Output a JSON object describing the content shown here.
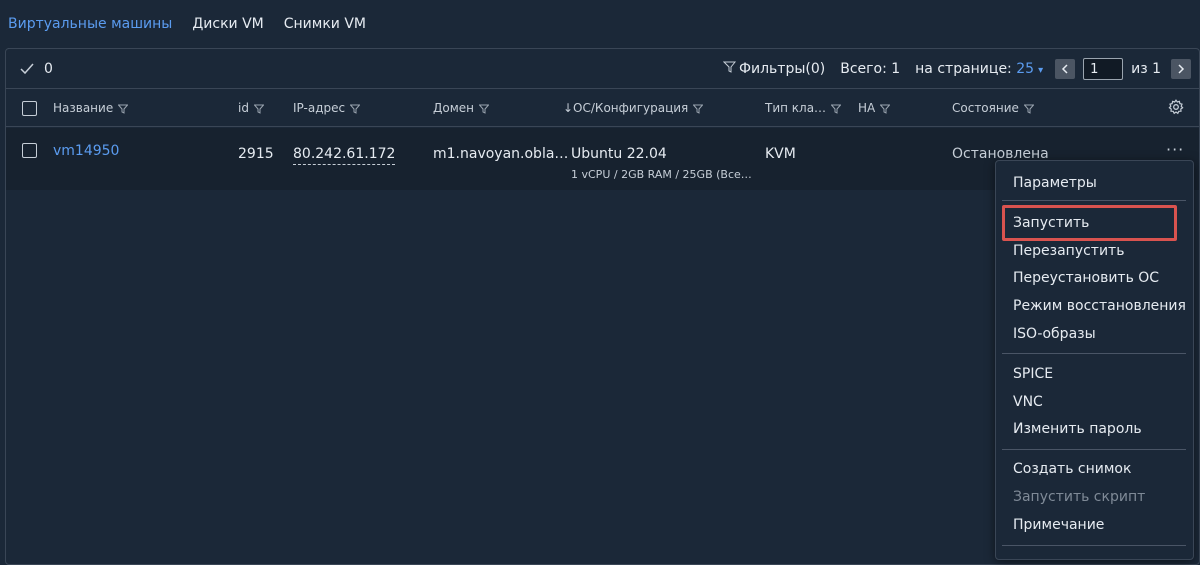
{
  "tabs": [
    {
      "label": "Виртуальные машины"
    },
    {
      "label": "Диски VM"
    },
    {
      "label": "Снимки VM"
    }
  ],
  "toolbar": {
    "selected_count": "0",
    "filters_label": "Фильтры(0)",
    "total_label": "Всего: 1",
    "per_page_label": "на странице:",
    "per_page_value": "25",
    "page_value": "1",
    "of_label": "из 1"
  },
  "columns": {
    "name": "Название",
    "id": "id",
    "ip": "IP-адрес",
    "domain": "Домен",
    "os": "↓ОС/Конфигурация",
    "type": "Тип кла…",
    "ha": "НА",
    "state": "Состояние"
  },
  "row": {
    "name": "vm14950",
    "id": "2915",
    "ip": "80.242.61.172",
    "domain": "m1.navoyan.obla…",
    "os": "Ubuntu 22.04",
    "config": "1 vCPU / 2GB RAM / 25GB (Все…",
    "type": "KVM",
    "state": "Остановлена",
    "more": "···"
  },
  "menu": {
    "items": [
      "Параметры",
      "Запустить",
      "Перезапустить",
      "Переустановить ОС",
      "Режим восстановления",
      "ISO-образы",
      "SPICE",
      "VNC",
      "Изменить пароль",
      "Создать снимок",
      "Запустить скрипт",
      "Примечание"
    ]
  },
  "colors": {
    "background": "#1b2838",
    "accent": "#5b9cf0",
    "highlight": "#d9534f"
  }
}
